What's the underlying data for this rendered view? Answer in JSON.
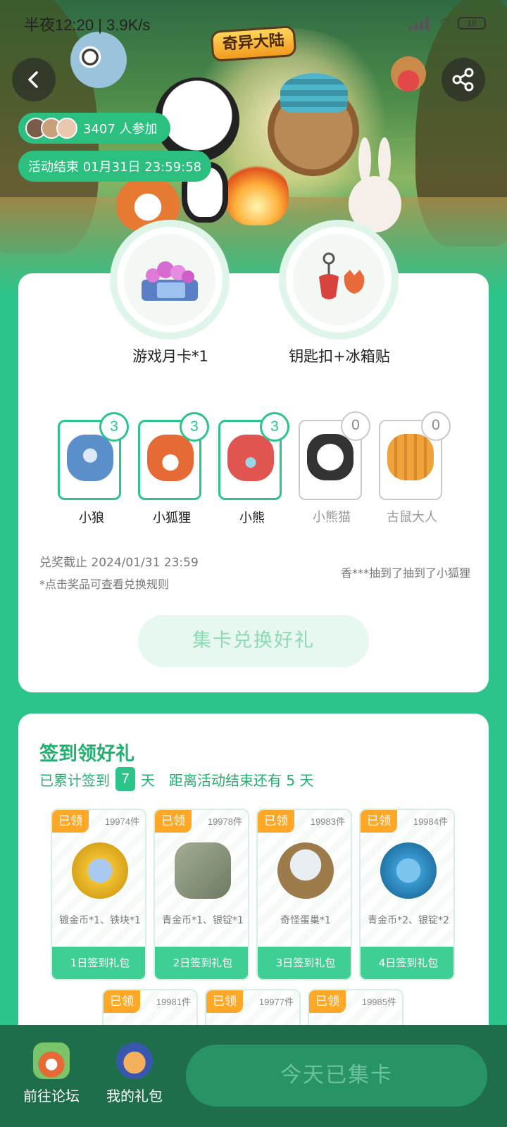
{
  "status_bar": {
    "time_speed": "半夜12:20 | 3.9K/s",
    "battery": "18"
  },
  "hero": {
    "logo_text": "奇异大陆",
    "participants": "3407 人参加",
    "end_time": "活动结束 01月31日 23:59:58"
  },
  "prizes": [
    {
      "label": "游戏月卡*1",
      "icon": "gem-cart-icon"
    },
    {
      "label": "钥匙扣+冰箱贴",
      "icon": "keychain-icon"
    }
  ],
  "collect_cards": [
    {
      "name": "小狼",
      "count": "3",
      "owned": true,
      "color": "#5a8fc9"
    },
    {
      "name": "小狐狸",
      "count": "3",
      "owned": true,
      "color": "#e66a36"
    },
    {
      "name": "小熊",
      "count": "3",
      "owned": true,
      "color": "#e0554f"
    },
    {
      "name": "小熊猫",
      "count": "0",
      "owned": false,
      "color": "#333333"
    },
    {
      "name": "古鼠大人",
      "count": "0",
      "owned": false,
      "color": "#f0a33c"
    }
  ],
  "redeem": {
    "deadline": "兑奖截止 2024/01/31 23:59",
    "note": "*点击奖品可查看兑换规则",
    "winner": "香***抽到了抽到了小狐狸",
    "button": "集卡兑换好礼"
  },
  "signin": {
    "title": "签到领好礼",
    "prefix": "已累计签到",
    "days": "7",
    "suffix": "天",
    "remaining": "距离活动结束还有 5 天",
    "gifts": [
      {
        "tag": "已领",
        "stock": "19974件",
        "desc": "镀金币*1、铁块*1",
        "footer": "1日签到礼包",
        "color": "#f1c232"
      },
      {
        "tag": "已领",
        "stock": "19978件",
        "desc": "青金币*1、银锭*1",
        "footer": "2日签到礼包",
        "color": "#7d8a6e"
      },
      {
        "tag": "已领",
        "stock": "19983件",
        "desc": "奇怪蛋巢*1",
        "footer": "3日签到礼包",
        "color": "#9c7a4a"
      },
      {
        "tag": "已领",
        "stock": "19984件",
        "desc": "青金币*2、银锭*2",
        "footer": "4日签到礼包",
        "color": "#3a9ad1"
      },
      {
        "tag": "已领",
        "stock": "19981件"
      },
      {
        "tag": "已领",
        "stock": "19977件"
      },
      {
        "tag": "已领",
        "stock": "19985件"
      }
    ]
  },
  "bottom_bar": {
    "forum": "前往论坛",
    "my_gifts": "我的礼包",
    "collect_today": "今天已集卡"
  }
}
